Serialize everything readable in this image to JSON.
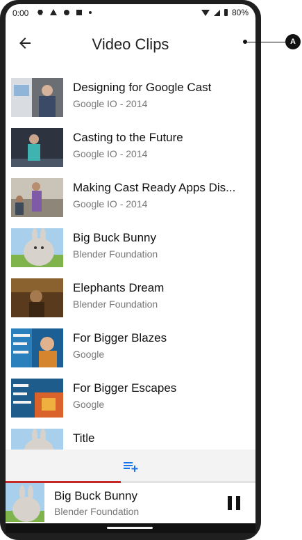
{
  "status_bar": {
    "time": "0:00",
    "battery": "80%"
  },
  "app_bar": {
    "title": "Video Clips"
  },
  "annotation": {
    "badge": "A"
  },
  "videos": [
    {
      "title": "Designing for Google Cast",
      "subtitle": "Google IO - 2014"
    },
    {
      "title": "Casting to the Future",
      "subtitle": "Google IO - 2014"
    },
    {
      "title": "Making Cast Ready Apps Dis...",
      "subtitle": "Google IO - 2014"
    },
    {
      "title": "Big Buck Bunny",
      "subtitle": "Blender Foundation"
    },
    {
      "title": "Elephants Dream",
      "subtitle": "Blender Foundation"
    },
    {
      "title": "For Bigger Blazes",
      "subtitle": "Google"
    },
    {
      "title": "For Bigger Escapes",
      "subtitle": "Google"
    },
    {
      "title": "Title",
      "subtitle": ""
    }
  ],
  "mini_controller": {
    "title": "Big Buck Bunny",
    "subtitle": "Blender Foundation",
    "progress_fraction": 0.46
  },
  "icons": {
    "back": "arrow-left-icon",
    "queue": "playlist-add-icon",
    "pause": "pause-icon"
  },
  "colors": {
    "accent_blue": "#1a73e8",
    "progress_red": "#c62828"
  }
}
